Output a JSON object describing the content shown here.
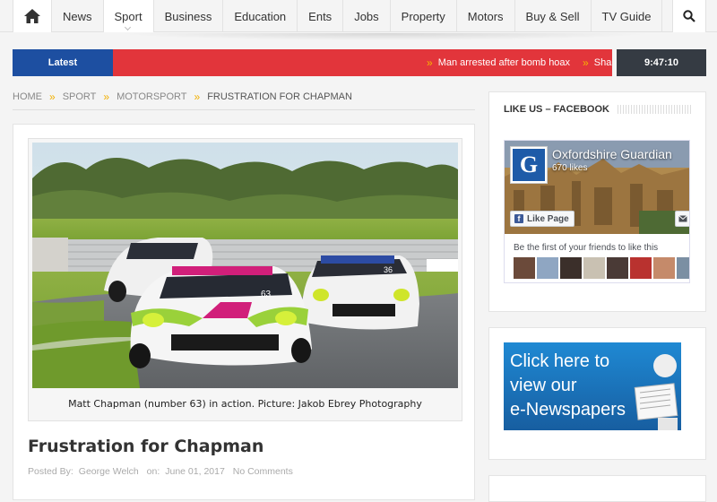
{
  "nav": {
    "items": [
      {
        "label": "News",
        "active": false
      },
      {
        "label": "Sport",
        "active": true
      },
      {
        "label": "Business",
        "active": false
      },
      {
        "label": "Education",
        "active": false
      },
      {
        "label": "Ents",
        "active": false
      },
      {
        "label": "Jobs",
        "active": false
      },
      {
        "label": "Property",
        "active": false
      },
      {
        "label": "Motors",
        "active": false
      },
      {
        "label": "Buy & Sell",
        "active": false
      },
      {
        "label": "TV Guide",
        "active": false
      }
    ],
    "home_icon": "home-icon",
    "search_icon": "search-icon"
  },
  "ticker": {
    "label": "Latest",
    "headlines": [
      "Man arrested after bomb hoax",
      "Sha"
    ],
    "time": "9:47:10"
  },
  "breadcrumb": {
    "items": [
      "HOME",
      "SPORT",
      "MOTORSPORT",
      "FRUSTRATION FOR CHAPMAN"
    ],
    "separator": "»"
  },
  "article": {
    "caption": "Matt Chapman (number 63) in action. Picture: Jakob Ebrey Photography",
    "title": "Frustration for Chapman",
    "meta": {
      "posted_by_label": "Posted By:",
      "author": "George Welch",
      "on_label": "on:",
      "date": "June 01, 2017",
      "comments": "No Comments"
    }
  },
  "sidebar": {
    "facebook": {
      "heading": "LIKE US – FACEBOOK",
      "logo_letter": "G",
      "page_name": "Oxfordshire Guardian",
      "likes": "670 likes",
      "like_button": "Like Page",
      "friends_text": "Be the first of your friends to like this"
    },
    "ad": {
      "lines": [
        "Click here to",
        "view our",
        "e-Newspapers"
      ]
    }
  },
  "colors": {
    "ticker_label": "#1d4fa1",
    "ticker_bar": "#e2353b",
    "ticker_chevron": "#f7b500",
    "time_box": "#353b43",
    "breadcrumb_separator": "#f2b000",
    "facebook_blue": "#3b5998"
  }
}
